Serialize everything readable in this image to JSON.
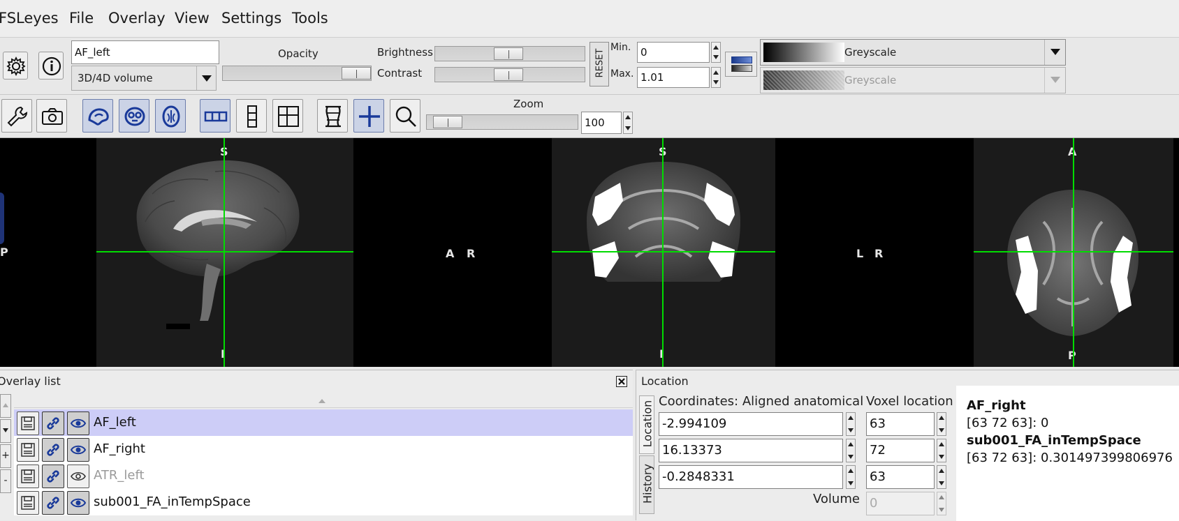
{
  "menu": {
    "app": "FSLeyes",
    "items": [
      "File",
      "Overlay",
      "View",
      "Settings",
      "Tools"
    ]
  },
  "overlay_toolbar": {
    "name_value": "AF_left",
    "type_value": "3D/4D volume",
    "opacity_label": "Opacity",
    "brightness_label": "Brightness",
    "contrast_label": "Contrast",
    "reset_label": "RESET",
    "min_label": "Min.",
    "max_label": "Max.",
    "min_value": "0",
    "max_value": "1.01",
    "cmap_value": "Greyscale",
    "neg_cmap_value": "Greyscale"
  },
  "view_toolbar": {
    "zoom_label": "Zoom",
    "zoom_value": "100",
    "zoom_level": 0.05
  },
  "canvas": {
    "sagittal": {
      "top": "S",
      "bottom": "I",
      "left": "P",
      "right": "A"
    },
    "coronal": {
      "top": "S",
      "bottom": "I",
      "left": "R",
      "right": "L"
    },
    "axial": {
      "top": "A",
      "bottom": "P",
      "left": "R"
    },
    "crosshair_color": "#00dd00"
  },
  "overlay_list": {
    "title": "Overlay list",
    "items": [
      {
        "name": "AF_left",
        "selected": true,
        "visible": true
      },
      {
        "name": "AF_right",
        "selected": false,
        "visible": true
      },
      {
        "name": "ATR_left",
        "selected": false,
        "visible": false
      },
      {
        "name": "sub001_FA_inTempSpace",
        "selected": false,
        "visible": true
      }
    ],
    "side_buttons": [
      "+",
      "-"
    ]
  },
  "location": {
    "title": "Location",
    "tabs": [
      "Location",
      "History"
    ],
    "coords_header": "Coordinates: Aligned anatomical",
    "voxel_header": "Voxel location",
    "coords": [
      "-2.994109",
      "16.13373",
      "-0.2848331"
    ],
    "voxels": [
      "63",
      "72",
      "63"
    ],
    "volume_label": "Volume",
    "volume_value": "0",
    "info": [
      {
        "name": "AF_right",
        "value": "[63 72 63]: 0"
      },
      {
        "name": "sub001_FA_inTempSpace",
        "value": "[63 72 63]: 0.301497399806976"
      }
    ]
  },
  "colors": {
    "selection": "#cdcdf7",
    "toggle_on": "#cbd3e6",
    "icon_blue": "#1a3a9a"
  }
}
